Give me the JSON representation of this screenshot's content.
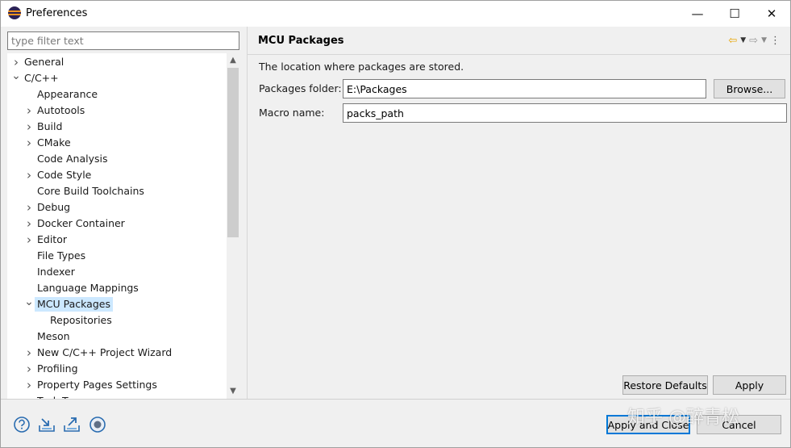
{
  "window": {
    "title": "Preferences",
    "minimize_glyph": "—",
    "maximize_glyph": "☐",
    "close_glyph": "✕"
  },
  "filter": {
    "placeholder": "type filter text",
    "value": ""
  },
  "tree": {
    "items": [
      {
        "label": "General",
        "level": 0,
        "expander": "collapsed"
      },
      {
        "label": "C/C++",
        "level": 0,
        "expander": "expanded"
      },
      {
        "label": "Appearance",
        "level": 1,
        "expander": "none"
      },
      {
        "label": "Autotools",
        "level": 1,
        "expander": "collapsed"
      },
      {
        "label": "Build",
        "level": 1,
        "expander": "collapsed"
      },
      {
        "label": "CMake",
        "level": 1,
        "expander": "collapsed"
      },
      {
        "label": "Code Analysis",
        "level": 1,
        "expander": "none"
      },
      {
        "label": "Code Style",
        "level": 1,
        "expander": "collapsed"
      },
      {
        "label": "Core Build Toolchains",
        "level": 1,
        "expander": "none"
      },
      {
        "label": "Debug",
        "level": 1,
        "expander": "collapsed"
      },
      {
        "label": "Docker Container",
        "level": 1,
        "expander": "collapsed"
      },
      {
        "label": "Editor",
        "level": 1,
        "expander": "collapsed"
      },
      {
        "label": "File Types",
        "level": 1,
        "expander": "none"
      },
      {
        "label": "Indexer",
        "level": 1,
        "expander": "none"
      },
      {
        "label": "Language Mappings",
        "level": 1,
        "expander": "none"
      },
      {
        "label": "MCU Packages",
        "level": 1,
        "expander": "expanded",
        "selected": true
      },
      {
        "label": "Repositories",
        "level": 2,
        "expander": "none"
      },
      {
        "label": "Meson",
        "level": 1,
        "expander": "none"
      },
      {
        "label": "New C/C++ Project Wizard",
        "level": 1,
        "expander": "collapsed"
      },
      {
        "label": "Profiling",
        "level": 1,
        "expander": "collapsed"
      },
      {
        "label": "Property Pages Settings",
        "level": 1,
        "expander": "collapsed"
      },
      {
        "label": "Task Tags",
        "level": 1,
        "expander": "collapsed"
      }
    ]
  },
  "page": {
    "title": "MCU Packages",
    "description": "The location where packages are stored.",
    "packages_folder_label": "Packages folder:",
    "packages_folder_value": "E:\\Packages",
    "browse_label": "Browse...",
    "macro_name_label": "Macro name:",
    "macro_name_value": "packs_path",
    "restore_defaults_label": "Restore Defaults",
    "apply_label": "Apply"
  },
  "footer": {
    "apply_and_close_label": "Apply and Close",
    "cancel_label": "Cancel"
  },
  "watermark": "知乎 @醉青松",
  "colors": {
    "selection": "#cce8ff",
    "back_arrow": "#e8a400",
    "default_button_border": "#0078d7",
    "footer_icons": "#2a6cb0"
  }
}
